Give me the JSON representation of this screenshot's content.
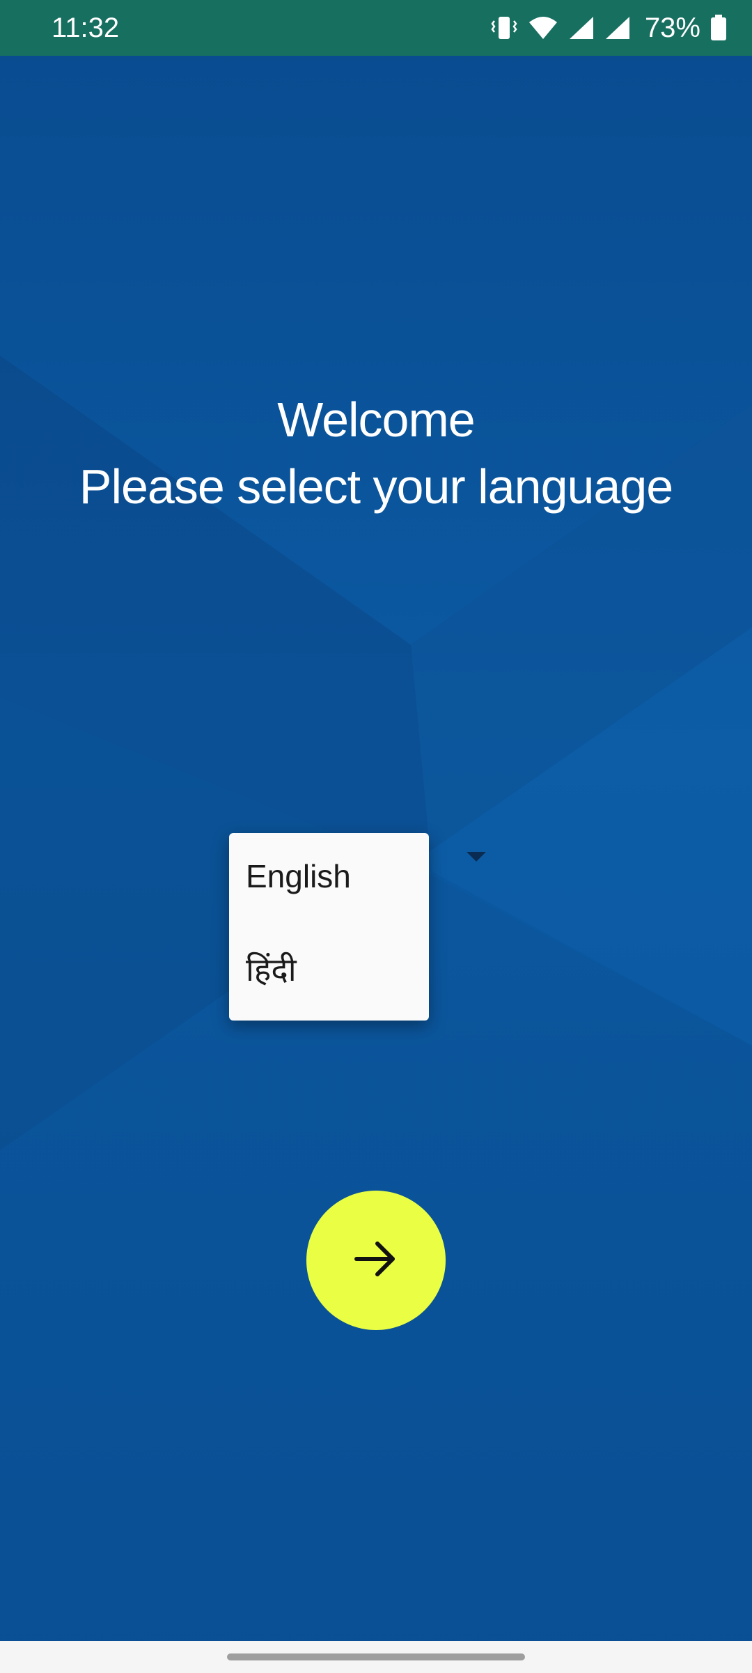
{
  "status_bar": {
    "time": "11:32",
    "battery_percent": "73%",
    "icons": [
      "vibrate-icon",
      "wifi-icon",
      "signal-icon",
      "signal-icon",
      "battery-icon"
    ]
  },
  "headline": {
    "line1": "Welcome",
    "line2": "Please select your language"
  },
  "language_dropdown": {
    "options": [
      {
        "label": "English"
      },
      {
        "label": "हिंदी"
      }
    ]
  },
  "next_button": {
    "icon": "arrow-right-icon",
    "color": "#eaff44"
  },
  "colors": {
    "status_bar": "#176f60",
    "background": "#0a4f93",
    "accent": "#eaff44"
  }
}
